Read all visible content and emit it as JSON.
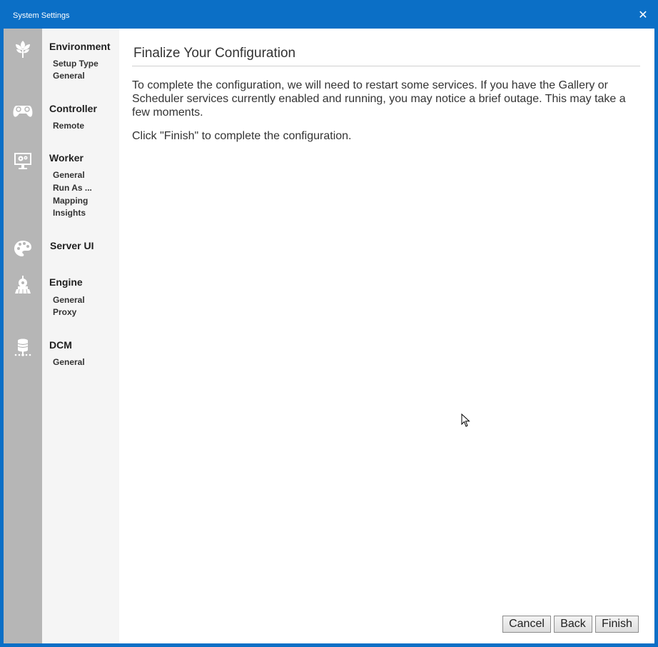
{
  "window": {
    "title": "System Settings"
  },
  "sidebar": {
    "sections": [
      {
        "icon": "leaf-icon",
        "label": "Environment",
        "items": [
          "Setup Type",
          "General"
        ]
      },
      {
        "icon": "gamepad-icon",
        "label": "Controller",
        "items": [
          "Remote"
        ]
      },
      {
        "icon": "monitor-gears-icon",
        "label": "Worker",
        "items": [
          "General",
          "Run As ...",
          "Mapping",
          "Insights"
        ]
      },
      {
        "icon": "palette-icon",
        "label": "Server UI",
        "items": []
      },
      {
        "icon": "locomotive-icon",
        "label": "Engine",
        "items": [
          "General",
          "Proxy"
        ]
      },
      {
        "icon": "database-icon",
        "label": "DCM",
        "items": [
          "General"
        ]
      }
    ]
  },
  "main": {
    "title": "Finalize Your Configuration",
    "paragraph1": "To complete the configuration, we will need to restart some services. If you have the Gallery or Scheduler services currently enabled and running, you may notice a brief outage. This may take a few moments.",
    "paragraph2": "Click \"Finish\" to complete the configuration."
  },
  "buttons": {
    "cancel": "Cancel",
    "back": "Back",
    "finish": "Finish"
  },
  "colors": {
    "titlebar": "#0b6fc6",
    "iconbar": "#b6b6b6",
    "nav": "#f5f5f5"
  }
}
